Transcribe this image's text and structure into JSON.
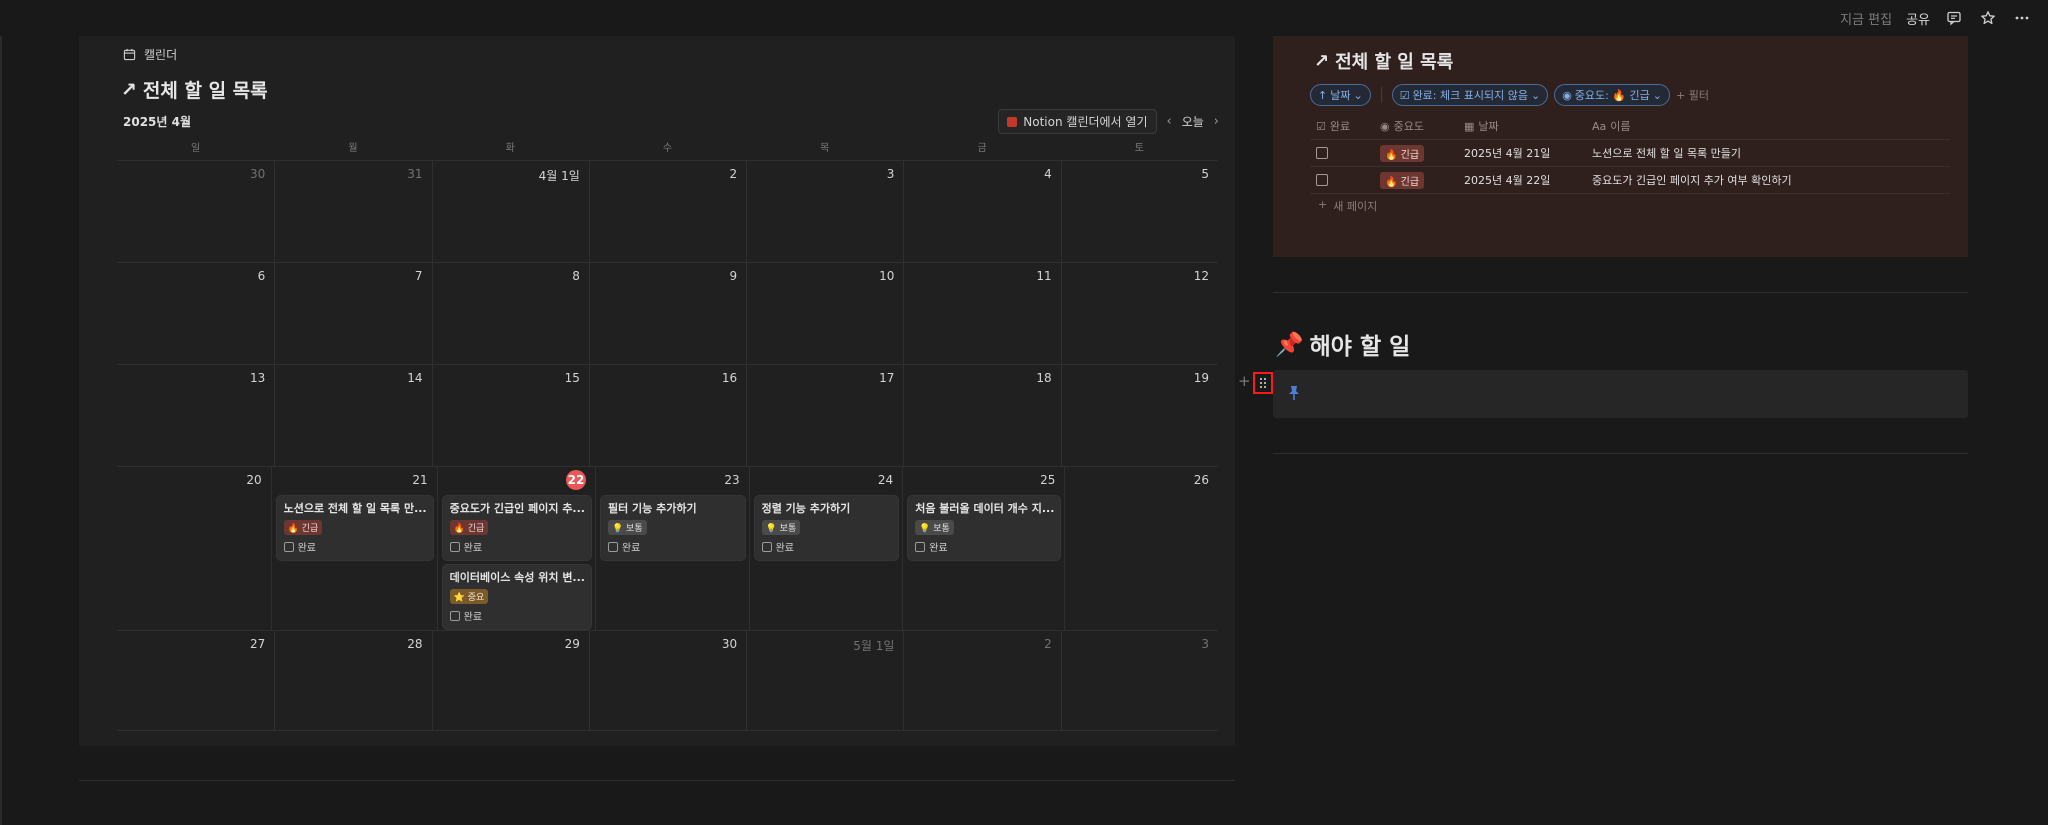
{
  "topbar": {
    "edited": "지금 편집",
    "share": "공유",
    "icons": [
      "comment-icon",
      "star-icon",
      "more-icon"
    ]
  },
  "calendar": {
    "view_label": "캘린더",
    "title": "전체 할 일 목록",
    "month": "2025년 4월",
    "open_button": "Notion 캘린더에서 열기",
    "today_button": "오늘",
    "weekdays": [
      "일",
      "월",
      "화",
      "수",
      "목",
      "금",
      "토"
    ],
    "weeks": [
      [
        {
          "d": "30",
          "dim": true
        },
        {
          "d": "31",
          "dim": true
        },
        {
          "d": "4월 1일"
        },
        {
          "d": "2"
        },
        {
          "d": "3"
        },
        {
          "d": "4"
        },
        {
          "d": "5"
        }
      ],
      [
        {
          "d": "6"
        },
        {
          "d": "7"
        },
        {
          "d": "8"
        },
        {
          "d": "9"
        },
        {
          "d": "10"
        },
        {
          "d": "11"
        },
        {
          "d": "12"
        }
      ],
      [
        {
          "d": "13"
        },
        {
          "d": "14"
        },
        {
          "d": "15"
        },
        {
          "d": "16"
        },
        {
          "d": "17"
        },
        {
          "d": "18"
        },
        {
          "d": "19"
        }
      ],
      [
        {
          "d": "20"
        },
        {
          "d": "21",
          "cards": [
            {
              "title": "노션으로 전체 할 일 목록 만...",
              "tag": "🔥 긴급",
              "tagType": "urgent",
              "check": "완료"
            }
          ]
        },
        {
          "d": "22",
          "today": true,
          "cards": [
            {
              "title": "중요도가 긴급인 페이지 추...",
              "tag": "🔥 긴급",
              "tagType": "urgent",
              "check": "완료"
            },
            {
              "title": "데이터베이스 속성 위치 변...",
              "tag": "⭐ 중요",
              "tagType": "important",
              "check": "완료"
            }
          ]
        },
        {
          "d": "23",
          "cards": [
            {
              "title": "필터 기능 추가하기",
              "tag": "💡 보통",
              "tagType": "normal",
              "check": "완료"
            }
          ]
        },
        {
          "d": "24",
          "cards": [
            {
              "title": "정렬 기능 추가하기",
              "tag": "💡 보통",
              "tagType": "normal",
              "check": "완료"
            }
          ]
        },
        {
          "d": "25",
          "cards": [
            {
              "title": "처음 불러올 데이터 개수 지...",
              "tag": "💡 보통",
              "tagType": "normal",
              "check": "완료"
            }
          ]
        },
        {
          "d": "26"
        }
      ],
      [
        {
          "d": "27"
        },
        {
          "d": "28"
        },
        {
          "d": "29"
        },
        {
          "d": "30"
        },
        {
          "d": "5월 1일",
          "dim": true
        },
        {
          "d": "2",
          "dim": true
        },
        {
          "d": "3",
          "dim": true
        }
      ]
    ]
  },
  "db": {
    "title": "전체 할 일 목록",
    "sort_chip": "날짜",
    "filter_done": "완료: 체크 표시되지 않음",
    "filter_priority": "중요도: 🔥 긴급",
    "add_filter": "+ 필터",
    "columns": [
      "완료",
      "중요도",
      "날짜",
      "이름"
    ],
    "col_prefix_name": "Aa",
    "rows": [
      {
        "priority": "🔥 긴급",
        "date": "2025년 4월 21일",
        "name": "노션으로 전체 할 일 목록 만들기"
      },
      {
        "priority": "🔥 긴급",
        "date": "2025년 4월 22일",
        "name": "중요도가 긴급인 페이지 추가 여부 확인하기"
      }
    ],
    "new_page": "새 페이지"
  },
  "todo": {
    "title": "해야 할 일",
    "emoji": "📌"
  }
}
